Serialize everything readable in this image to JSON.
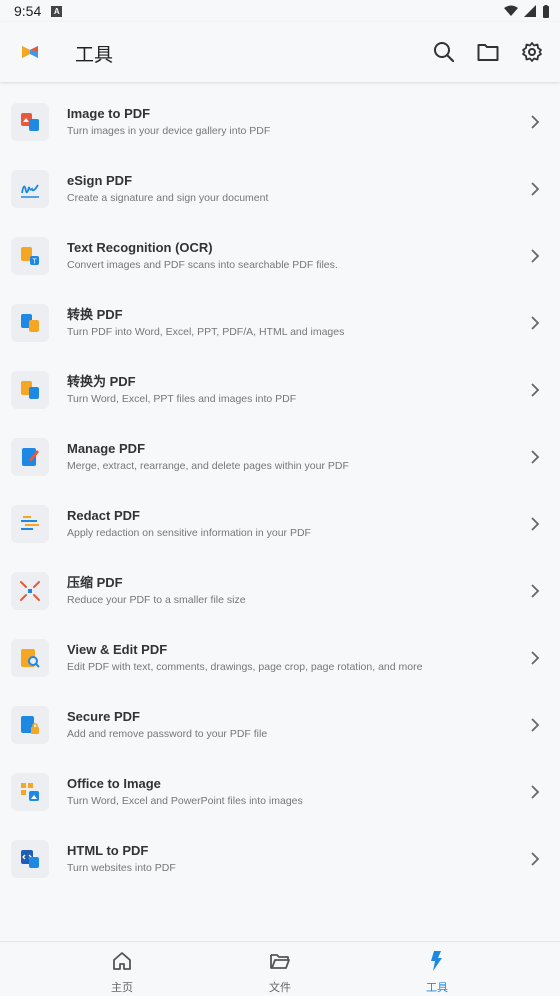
{
  "status": {
    "time": "9:54",
    "notif": "A"
  },
  "appbar": {
    "title": "工具"
  },
  "tools": [
    {
      "title": "Image to PDF",
      "desc": "Turn images in your device gallery into PDF",
      "icon": "image-to-pdf-icon"
    },
    {
      "title": "eSign PDF",
      "desc": "Create a signature and sign your document",
      "icon": "esign-icon"
    },
    {
      "title": "Text Recognition (OCR)",
      "desc": "Convert images and PDF scans into searchable PDF files.",
      "icon": "ocr-icon"
    },
    {
      "title": "转换 PDF",
      "desc": "Turn PDF into Word, Excel, PPT, PDF/A, HTML and images",
      "icon": "convert-pdf-icon"
    },
    {
      "title": "转换为 PDF",
      "desc": "Turn Word, Excel, PPT files and images into PDF",
      "icon": "convert-to-pdf-icon"
    },
    {
      "title": "Manage PDF",
      "desc": "Merge, extract, rearrange, and delete pages within your PDF",
      "icon": "manage-pdf-icon"
    },
    {
      "title": "Redact PDF",
      "desc": "Apply redaction on sensitive information in your PDF",
      "icon": "redact-icon"
    },
    {
      "title": "压缩 PDF",
      "desc": "Reduce your PDF to a smaller file size",
      "icon": "compress-icon"
    },
    {
      "title": "View & Edit PDF",
      "desc": "Edit PDF with text, comments, drawings, page crop, page rotation, and more",
      "icon": "view-edit-icon"
    },
    {
      "title": "Secure PDF",
      "desc": "Add and remove password to your PDF file",
      "icon": "secure-pdf-icon"
    },
    {
      "title": "Office to Image",
      "desc": "Turn Word, Excel and PowerPoint files into images",
      "icon": "office-to-image-icon"
    },
    {
      "title": "HTML to PDF",
      "desc": "Turn websites into PDF",
      "icon": "html-to-pdf-icon"
    }
  ],
  "nav": [
    {
      "label": "主页",
      "icon": "home-icon"
    },
    {
      "label": "文件",
      "icon": "folder-icon"
    },
    {
      "label": "工具",
      "icon": "tools-icon",
      "active": true
    }
  ],
  "colors": {
    "accent": "#1e88e5",
    "orange": "#f5a623",
    "red": "#e8583c"
  }
}
